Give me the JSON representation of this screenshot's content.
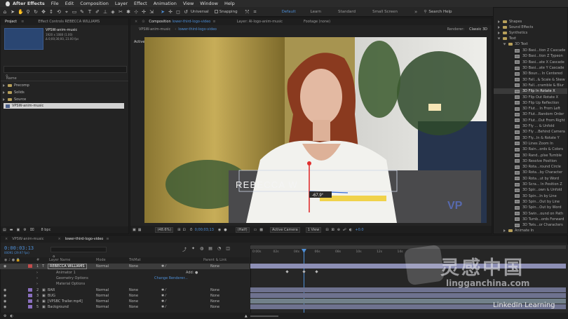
{
  "menubar": {
    "app": "After Effects",
    "items": [
      "File",
      "Edit",
      "Composition",
      "Layer",
      "Effect",
      "Animation",
      "View",
      "Window",
      "Help"
    ]
  },
  "toolbar": {
    "universal_label": "Universal",
    "snapping_label": "Snapping",
    "workspaces": [
      "Default",
      "Learn",
      "Standard",
      "Small Screen"
    ],
    "search_placeholder": "Search Help"
  },
  "project": {
    "tab": "Project",
    "effect_controls_tab": "Effect Controls REBECCA WILLIAMS",
    "item_name": "VPSW-anim-music",
    "item_size": "1920 x 1080 (1.00)",
    "item_duration": "Δ 0;00;30;00, 23.00 fps",
    "col_name": "Name",
    "items": [
      {
        "name": "Precomp",
        "type": "folder"
      },
      {
        "name": "Solids",
        "type": "folder"
      },
      {
        "name": "Source",
        "type": "folder"
      },
      {
        "name": "VPSW-anim-music",
        "type": "comp"
      }
    ],
    "bpc": "8 bpc"
  },
  "composition": {
    "tab_label": "Composition",
    "tab_name": "lower-third-logo-video",
    "layer_tab": "Layer: Al-logo-anim-music",
    "footage_tab": "Footage (none)",
    "sub_tabs": [
      "VPSW-anim-music",
      "lower-third-logo-video"
    ],
    "renderer_label": "Renderer:",
    "renderer_value": "Classic 3D",
    "viewer_label": "Active Camera",
    "overlay_text": "REBECCA W",
    "rotation_readout": "-67.9°",
    "watermark_letters": "VP",
    "footer": {
      "zoom": "(48.6%)",
      "timecode": "0;00;03;13",
      "resolution": "(Half)",
      "view": "Active Camera",
      "views": "1 View",
      "exposure": "+0.0"
    }
  },
  "effects": {
    "folders": [
      "Shapes",
      "Sound Effects",
      "Synthetics",
      "Text",
      "3D Text"
    ],
    "items": [
      "3D Basi...tion Z Cascade",
      "3D Basi...tion Z Typeon",
      "3D Basi...ate X Cascade",
      "3D Basi...ate Y Cascade",
      "3D Boun... In Centered",
      "3D Fall...& Scale & Skew",
      "3D Fall...cramble & Blur",
      "3D Flip In Rotate X",
      "3D Flip Out Rotate X",
      "3D Flip Up Reflection",
      "3D Flut... In From Left",
      "3D Flut...Random Order",
      "3D Flut...Out From Right",
      "3D Fly ... & Unfold",
      "3D Fly ...Behind Camera",
      "3D Fly...In & Rotate Y",
      "3D Lines Zoom In",
      "3D Rain...ords & Colors",
      "3D Rand...plse Tumble",
      "3D Resolve Position",
      "3D Rota...round Circle",
      "3D Rota...by Character",
      "3D Rota...ut by Word",
      "3D Scra... In Position Z",
      "3D Spir...own & Unfold",
      "3D Spin...In by Line",
      "3D Spin...Out by Line",
      "3D Spin...Out by Word",
      "3D Swin...ound on Path",
      "3D Tumb...ords Forward",
      "3D Twis...or Characters"
    ],
    "selected": "3D Flip In Rotate X",
    "footer": "Animate In"
  },
  "timeline": {
    "tabs": [
      "VPSW-anim-music",
      "lower-third-logo-video"
    ],
    "timecode": "0:00:03:13",
    "timecode_sub": "00091 (29.97 fps)",
    "headers": {
      "layer_name": "Layer Name",
      "mode": "Mode",
      "trkmat": "TrkMat",
      "parent": "Parent & Link"
    },
    "ruler": [
      "0:00s",
      "02s",
      "04s",
      "06s",
      "08s",
      "10s",
      "12s",
      "14s"
    ],
    "layers": [
      {
        "num": "1",
        "name": "REBECCA WILLIAMS",
        "mode": "Normal",
        "trkmat": "None",
        "parent": "None",
        "selected": true
      },
      {
        "num": "",
        "name": "Animator 1",
        "mode": "",
        "trkmat": "",
        "parent": "",
        "extra": "Add: ●"
      },
      {
        "num": "",
        "name": "Geometry Options",
        "mode": "",
        "trkmat": "",
        "parent": "",
        "extra": "Change Renderer..."
      },
      {
        "num": "",
        "name": "Material Options",
        "mode": "",
        "trkmat": "",
        "parent": ""
      },
      {
        "num": "2",
        "name": "BAR",
        "mode": "Normal",
        "trkmat": "None",
        "parent": "None"
      },
      {
        "num": "3",
        "name": "BUG",
        "mode": "Normal",
        "trkmat": "None",
        "parent": "None"
      },
      {
        "num": "4",
        "name": "[VPSBC Trailer.mp4]",
        "mode": "Normal",
        "trkmat": "None",
        "parent": "None"
      },
      {
        "num": "5",
        "name": "Background",
        "mode": "Normal",
        "trkmat": "None",
        "parent": "None"
      }
    ]
  },
  "watermarks": {
    "logo_text": "灵感中国",
    "logo_url": "lingganchina.com",
    "linkedin": "LinkedIn Learning"
  },
  "colors": {
    "accent": "#4d8ed6",
    "playhead": "#4d8ed6",
    "track_bar": "#7b7f9e",
    "label_red": "#c24c4c"
  }
}
